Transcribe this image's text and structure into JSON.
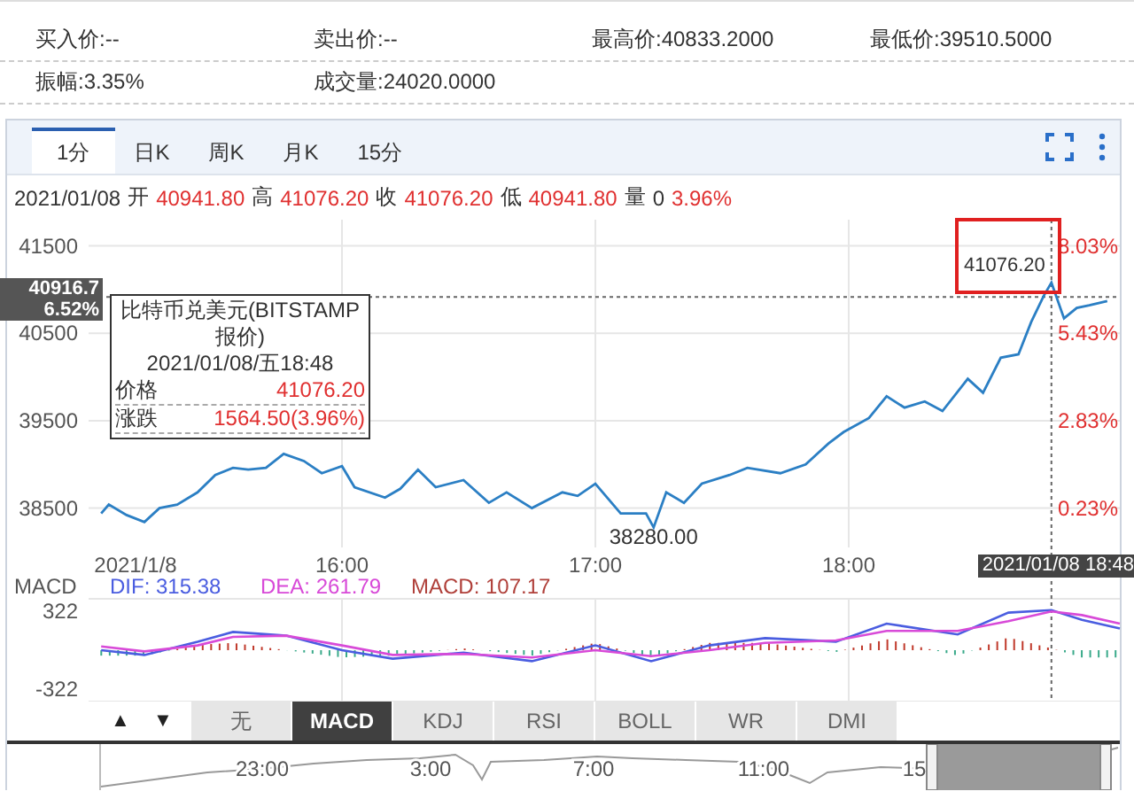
{
  "info_rows": [
    [
      "买入价:--",
      "卖出价:--",
      "最高价:40833.2000",
      "最低价:39510.5000"
    ],
    [
      "振幅:3.35%",
      "成交量:24020.0000"
    ]
  ],
  "chart_panel": {
    "tabs": [
      {
        "label": "1分",
        "selected": true
      },
      {
        "label": "日K",
        "selected": false
      },
      {
        "label": "周K",
        "selected": false
      },
      {
        "label": "月K",
        "selected": false
      },
      {
        "label": "15分",
        "selected": false
      }
    ],
    "quote_line": {
      "date": "2021/01/08",
      "fields": [
        {
          "label": "开",
          "value": "40941.80",
          "color": "#e03030"
        },
        {
          "label": "高",
          "value": "41076.20",
          "color": "#e03030"
        },
        {
          "label": "收",
          "value": "41076.20",
          "color": "#e03030"
        },
        {
          "label": "低",
          "value": "40941.80",
          "color": "#e03030"
        },
        {
          "label": "量",
          "value": "0",
          "color": "#333333"
        }
      ],
      "change": "3.96%"
    },
    "price_chart": {
      "chart_data": {
        "type": "line",
        "x": [
          15.05,
          15.08,
          15.15,
          15.22,
          15.28,
          15.35,
          15.43,
          15.5,
          15.57,
          15.63,
          15.7,
          15.77,
          15.85,
          15.92,
          16,
          16.05,
          16.17,
          16.23,
          16.3,
          16.37,
          16.48,
          16.58,
          16.65,
          16.75,
          16.87,
          16.93,
          17,
          17.1,
          17.2,
          17.23,
          17.28,
          17.35,
          17.42,
          17.53,
          17.6,
          17.73,
          17.83,
          17.92,
          17.98,
          18.08,
          18.15,
          18.22,
          18.3,
          18.37,
          18.47,
          18.53,
          18.6,
          18.67,
          18.72,
          18.77,
          18.8,
          18.85,
          18.9,
          18.95,
          19.02
        ],
        "series": [
          {
            "color": "#2b7fc4",
            "values": [
              38440,
              38540,
              38420,
              38340,
              38500,
              38540,
              38680,
              38880,
              38960,
              38940,
              38960,
              39120,
              39040,
              38900,
              38980,
              38740,
              38620,
              38720,
              38940,
              38740,
              38820,
              38560,
              38680,
              38500,
              38680,
              38640,
              38780,
              38440,
              38440,
              38280,
              38680,
              38560,
              38780,
              38880,
              38960,
              38900,
              39000,
              39240,
              39370,
              39530,
              39780,
              39650,
              39720,
              39610,
              39980,
              39820,
              40220,
              40260,
              40630,
              40930,
              41080,
              40670,
              40790,
              40820,
              40870
            ]
          }
        ],
        "xlim": [
          15,
          19.07
        ],
        "ylim": [
          38050,
          41800
        ],
        "grid": true,
        "ref_lines": [
          {
            "axis": "y",
            "value": 40916.7
          },
          {
            "axis": "x",
            "value": 18.8
          }
        ],
        "xticks": [
          {
            "value": 15.05,
            "label": "2021/1/8"
          },
          {
            "value": 16,
            "label": "16:00"
          },
          {
            "value": 17,
            "label": "17:00"
          },
          {
            "value": 18,
            "label": "18:00"
          }
        ],
        "yticks": [
          38500,
          39500,
          40500,
          41500
        ]
      },
      "right_axis_labels": [
        "8.03%",
        "5.43%",
        "2.83%",
        "0.23%"
      ],
      "low_label": "38280.00",
      "price_marker": {
        "price": "40916.7",
        "change": "6.52%"
      },
      "crosshair": {
        "price": "41076.20",
        "time": "2021/01/08 18:48"
      },
      "tooltip": {
        "title": "比特币兑美元(BITSTAMP报价)",
        "date": "2021/01/08/五18:48",
        "rows": [
          {
            "label": "价格",
            "value": "41076.20"
          },
          {
            "label": "涨跌",
            "value": "1564.50(3.96%)"
          }
        ]
      }
    },
    "macd": {
      "title": "MACD",
      "legend": [
        {
          "label": "DIF: 315.38",
          "color": "#4a5de0"
        },
        {
          "label": "DEA: 261.79",
          "color": "#d84ad8"
        },
        {
          "label": "MACD: 107.17",
          "color": "#b0403a"
        }
      ],
      "chart_data": {
        "type": "line",
        "x": [
          15.05,
          15.22,
          15.43,
          15.57,
          15.78,
          16,
          16.2,
          16.48,
          16.75,
          17,
          17.22,
          17.45,
          17.67,
          17.95,
          18.15,
          18.43,
          18.63,
          18.8,
          18.92,
          19.07
        ],
        "series": [
          {
            "color": "#4a5de0",
            "values": [
              0,
              -40,
              70,
              150,
              120,
              0,
              -70,
              -20,
              -90,
              40,
              -90,
              40,
              100,
              70,
              220,
              130,
              310,
              330,
              250,
              180
            ]
          },
          {
            "color": "#d84ad8",
            "values": [
              30,
              -10,
              40,
              110,
              120,
              40,
              -40,
              -30,
              -60,
              0,
              -50,
              0,
              60,
              80,
              160,
              160,
              240,
              320,
              290,
              220
            ]
          }
        ],
        "xlim": [
          15,
          19.07
        ],
        "ylim": [
          -424,
          424
        ],
        "yticks": [
          -322,
          322
        ],
        "grid": true,
        "ref_lines": [
          {
            "axis": "x",
            "value": 18.8
          }
        ]
      }
    },
    "scroll_buttons": [
      "▲",
      "▼"
    ],
    "indicator_tabs": [
      {
        "label": "无",
        "selected": false
      },
      {
        "label": "MACD",
        "selected": true
      },
      {
        "label": "KDJ",
        "selected": false
      },
      {
        "label": "RSI",
        "selected": false
      },
      {
        "label": "BOLL",
        "selected": false
      },
      {
        "label": "WR",
        "selected": false
      },
      {
        "label": "DMI",
        "selected": false
      }
    ],
    "navigator": {
      "labels": [
        "23:00",
        "3:00",
        "7:00",
        "11:00",
        "15"
      ]
    }
  }
}
